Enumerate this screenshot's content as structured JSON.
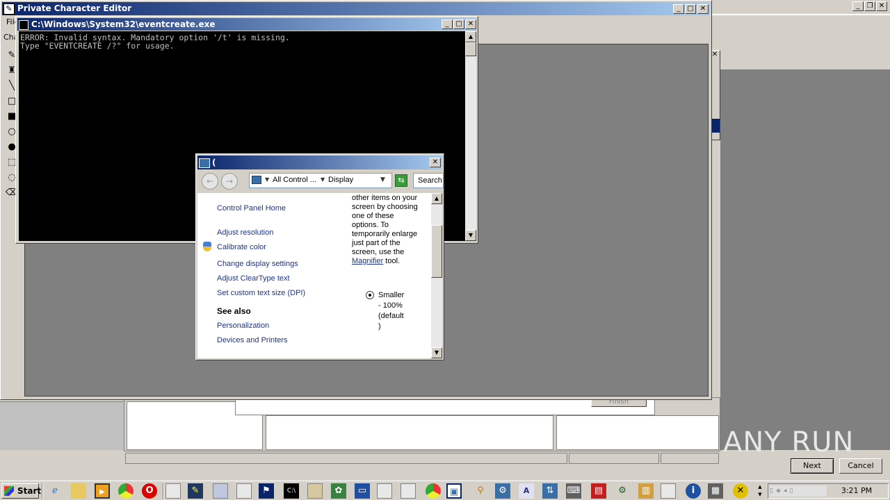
{
  "desktop": {
    "watermark": "ANY RUN"
  },
  "pce": {
    "title": "Private Character Editor",
    "menu_file": "File",
    "char_label": "Cha"
  },
  "console": {
    "title": "C:\\Windows\\System32\\eventcreate.exe",
    "line1": "ERROR: Invalid syntax. Mandatory option '/t' is missing.",
    "line2": "Type \"EVENTCREATE /?\" for usage."
  },
  "wizard": {
    "finish_label": "Finish",
    "next_label": "Next",
    "cancel_label": "Cancel"
  },
  "display": {
    "title": "(",
    "address": {
      "segment1": "All Control ...",
      "segment2": "Display"
    },
    "search_placeholder": "Search",
    "sidebar": {
      "home": "Control Panel Home",
      "links": [
        "Adjust resolution",
        "Calibrate color",
        "Change display settings",
        "Adjust ClearType text",
        "Set custom text size (DPI)"
      ],
      "see_also_heading": "See also",
      "see_also": [
        "Personalization",
        "Devices and Printers"
      ]
    },
    "content": {
      "para_lines": [
        "other items on your",
        "screen by choosing",
        "one of these",
        "options. To",
        "temporarily enlarge",
        "just part of the",
        "screen, use the"
      ],
      "magnifier_link": "Magnifier",
      "magnifier_suffix": " tool.",
      "option_lines": [
        "Smaller",
        "- 100%",
        "(default",
        ")"
      ]
    }
  },
  "taskbar": {
    "start_label": "Start",
    "clock": "3:21 PM"
  }
}
